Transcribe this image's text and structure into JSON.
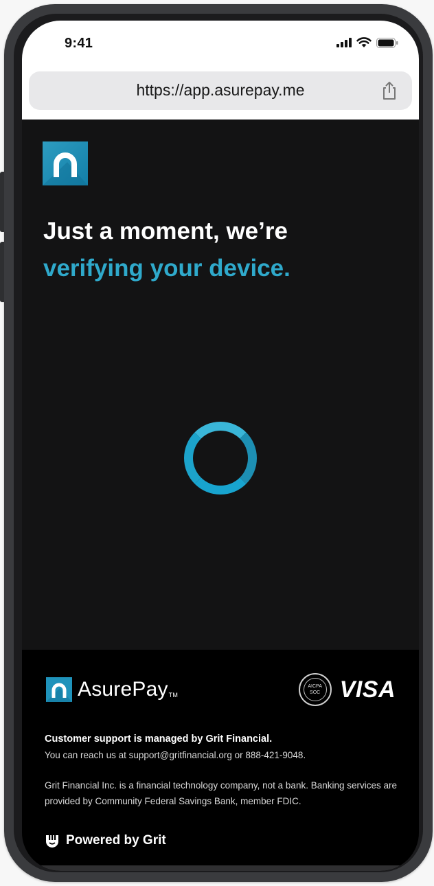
{
  "status_bar": {
    "time": "9:41"
  },
  "browser": {
    "url": "https://app.asurepay.me"
  },
  "main": {
    "headline_line1": "Just a moment, we’re",
    "headline_line2": "verifying your device."
  },
  "footer": {
    "brand_name": "AsurePay",
    "brand_tm": "TM",
    "soc_badge": {
      "line1": "AICPA",
      "line2": "SOC"
    },
    "visa_label": "VISA",
    "support_title": "Customer support is managed by Grit Financial.",
    "support_line": "You can reach us at support@gritfinancial.org or 888-421-9048.",
    "disclaimer": "Grit Financial Inc. is a financial technology company, not a bank. Banking services are provided by Community Federal Savings Bank, member FDIC.",
    "powered_by": "Powered by Grit"
  },
  "colors": {
    "accent": "#2fa9cb",
    "background": "#131314",
    "footer_background": "#000000",
    "phone_frame": "#3a3b3e"
  },
  "icons": [
    "asurepay-logo-icon",
    "cellular-signal-icon",
    "wifi-icon",
    "battery-icon",
    "share-icon",
    "loading-spinner",
    "aicpa-soc-badge-icon",
    "visa-logo",
    "grit-logo-icon"
  ]
}
